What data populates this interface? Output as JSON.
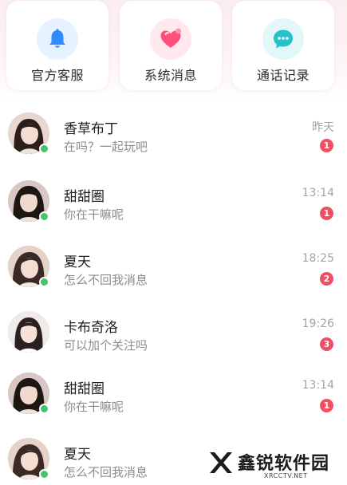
{
  "quick_actions": [
    {
      "label": "官方客服",
      "icon": "bell-icon",
      "color": "#2f8cff"
    },
    {
      "label": "系统消息",
      "icon": "heart-icon",
      "color": "#ff4f7a"
    },
    {
      "label": "通话记录",
      "icon": "chat-bubble-icon",
      "color": "#25c2c9"
    }
  ],
  "messages": [
    {
      "name": "香草布丁",
      "preview": "在吗？一起玩吧",
      "time": "昨天",
      "unread": "1",
      "online": true
    },
    {
      "name": "甜甜圈",
      "preview": "你在干嘛呢",
      "time": "13:14",
      "unread": "1",
      "online": true
    },
    {
      "name": "夏天",
      "preview": "怎么不回我消息",
      "time": "18:25",
      "unread": "2",
      "online": true
    },
    {
      "name": "卡布奇洛",
      "preview": "可以加个关注吗",
      "time": "19:26",
      "unread": "3",
      "online": false
    },
    {
      "name": "甜甜圈",
      "preview": "你在干嘛呢",
      "time": "13:14",
      "unread": "1",
      "online": true
    },
    {
      "name": "夏天",
      "preview": "怎么不回我消息",
      "time": "",
      "unread": "",
      "online": true
    }
  ],
  "colors": {
    "online": "#46c36f",
    "badge": "#f14e61"
  },
  "watermark": {
    "text": "鑫锐软件园",
    "sub": "XRCCTV.NET"
  }
}
